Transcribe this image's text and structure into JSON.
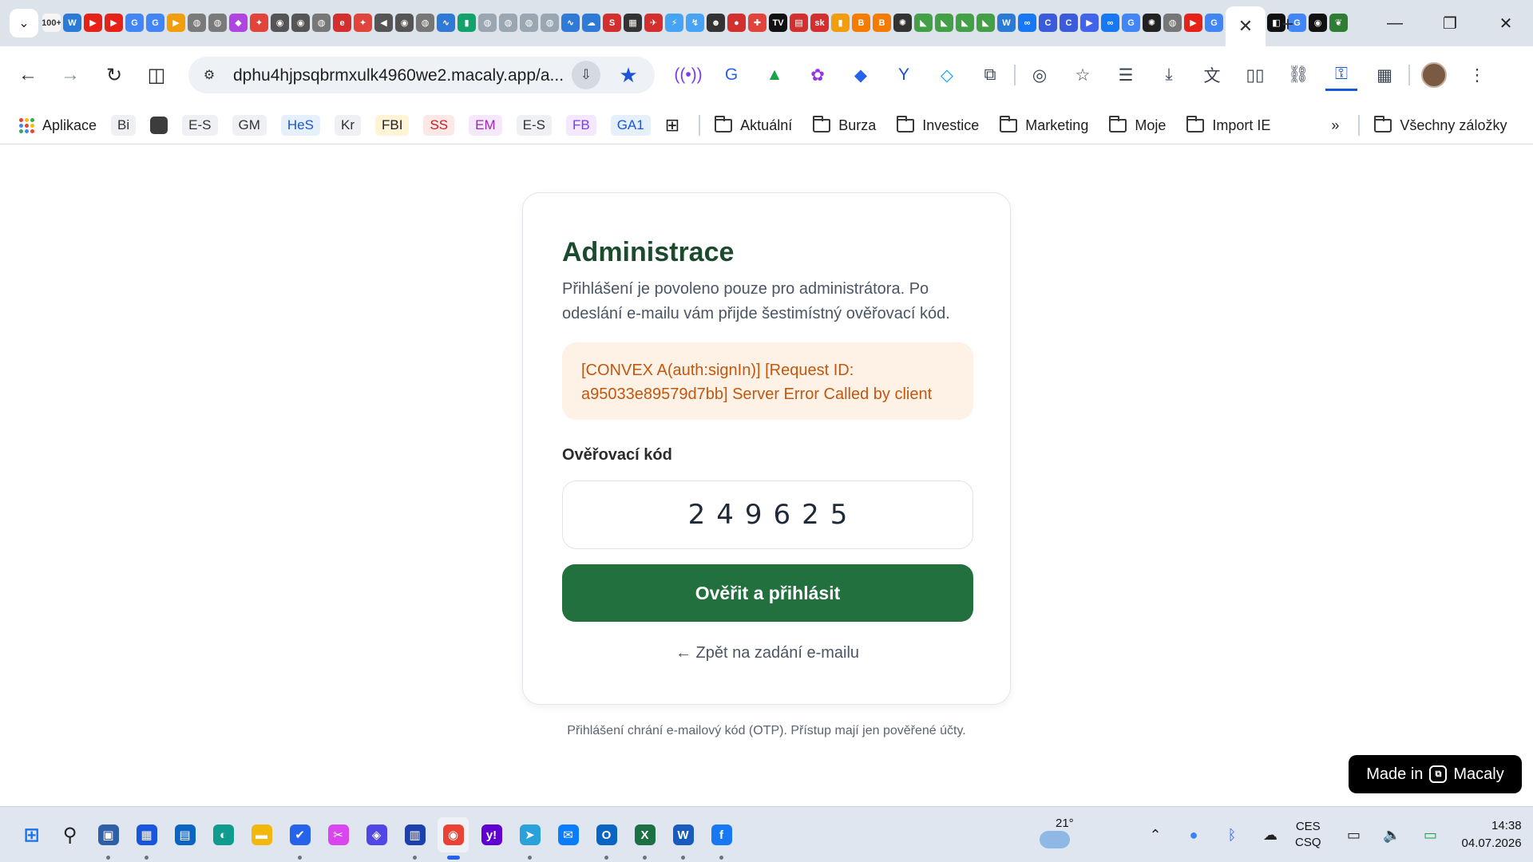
{
  "browser": {
    "url": "dphu4hjpsqbrmxulk4960we2.macaly.app/a...",
    "pinned_tabs": [
      {
        "icon": "100plus-icon",
        "text": "100+",
        "color": "#f5f5f5"
      },
      {
        "icon": "w-icon",
        "text": "W",
        "color": "#2b7bd6"
      },
      {
        "icon": "youtube-icon",
        "text": "▶",
        "color": "#e62117"
      },
      {
        "icon": "youtube-icon",
        "text": "▶",
        "color": "#e62117"
      },
      {
        "icon": "google-icon",
        "text": "G",
        "color": "#4285f4"
      },
      {
        "icon": "google-icon",
        "text": "G",
        "color": "#4285f4"
      },
      {
        "icon": "play-icon",
        "text": "▶",
        "color": "#f29d0c"
      },
      {
        "icon": "globe-icon",
        "text": "◍",
        "color": "#7a7a7a"
      },
      {
        "icon": "globe-icon",
        "text": "◍",
        "color": "#7a7a7a"
      },
      {
        "icon": "app-icon",
        "text": "◆",
        "color": "#b044e0"
      },
      {
        "icon": "bird-icon",
        "text": "✦",
        "color": "#e0443a"
      },
      {
        "icon": "eye-icon",
        "text": "◉",
        "color": "#555555"
      },
      {
        "icon": "eye-icon",
        "text": "◉",
        "color": "#555555"
      },
      {
        "icon": "globe-icon",
        "text": "◍",
        "color": "#777777"
      },
      {
        "icon": "red-app-icon",
        "text": "e",
        "color": "#d32f2f"
      },
      {
        "icon": "bird-icon",
        "text": "✦",
        "color": "#e0443a"
      },
      {
        "icon": "speaker-icon",
        "text": "◀",
        "color": "#555555"
      },
      {
        "icon": "eye-icon",
        "text": "◉",
        "color": "#555555"
      },
      {
        "icon": "globe-icon",
        "text": "◍",
        "color": "#777777"
      },
      {
        "icon": "chart-icon",
        "text": "∿",
        "color": "#2f7ad6"
      },
      {
        "icon": "bars-icon",
        "text": "▮",
        "color": "#12a36d"
      },
      {
        "icon": "globe-icon",
        "text": "◍",
        "color": "#9aa6b2"
      },
      {
        "icon": "globe-icon",
        "text": "◍",
        "color": "#9aa6b2"
      },
      {
        "icon": "globe-icon",
        "text": "◍",
        "color": "#9aa6b2"
      },
      {
        "icon": "globe-icon",
        "text": "◍",
        "color": "#9aa6b2"
      },
      {
        "icon": "chart-icon",
        "text": "∿",
        "color": "#2f7ad6"
      },
      {
        "icon": "cloud-icon",
        "text": "☁",
        "color": "#2f7ad6"
      },
      {
        "icon": "s-icon",
        "text": "S",
        "color": "#d32f2f"
      },
      {
        "icon": "vault-icon",
        "text": "▦",
        "color": "#333333"
      },
      {
        "icon": "plane-icon",
        "text": "✈",
        "color": "#d32f2f"
      },
      {
        "icon": "stats-icon",
        "text": "⚡",
        "color": "#47a3f3"
      },
      {
        "icon": "zig-icon",
        "text": "↯",
        "color": "#47a3f3"
      },
      {
        "icon": "person-icon",
        "text": "☻",
        "color": "#333333"
      },
      {
        "icon": "red-dot-icon",
        "text": "●",
        "color": "#d32f2f"
      },
      {
        "icon": "plus-icon",
        "text": "✚",
        "color": "#e0443a"
      },
      {
        "icon": "tv-icon",
        "text": "TV",
        "color": "#111111"
      },
      {
        "icon": "news-icon",
        "text": "▤",
        "color": "#d32f2f"
      },
      {
        "icon": "sk-icon",
        "text": "sk",
        "color": "#d32f2f"
      },
      {
        "icon": "bars-icon",
        "text": "▮",
        "color": "#f29d0c"
      },
      {
        "icon": "b-icon",
        "text": "B",
        "color": "#f57c00"
      },
      {
        "icon": "blogger-icon",
        "text": "B",
        "color": "#f57c00"
      },
      {
        "icon": "openai-icon",
        "text": "✺",
        "color": "#333333"
      },
      {
        "icon": "green-icon",
        "text": "◣",
        "color": "#43a047"
      },
      {
        "icon": "green-icon",
        "text": "◣",
        "color": "#43a047"
      },
      {
        "icon": "green-icon",
        "text": "◣",
        "color": "#43a047"
      },
      {
        "icon": "green-icon",
        "text": "◣",
        "color": "#43a047"
      },
      {
        "icon": "w-icon",
        "text": "W",
        "color": "#2b7bd6"
      },
      {
        "icon": "meta-icon",
        "text": "∞",
        "color": "#1877f2"
      },
      {
        "icon": "c-icon",
        "text": "C",
        "color": "#3b5bdb"
      },
      {
        "icon": "c-icon",
        "text": "C",
        "color": "#3b5bdb"
      },
      {
        "icon": "play-icon",
        "text": "▶",
        "color": "#4263eb"
      },
      {
        "icon": "meta-icon",
        "text": "∞",
        "color": "#1877f2"
      },
      {
        "icon": "google-icon",
        "text": "G",
        "color": "#4285f4"
      },
      {
        "icon": "openai-icon",
        "text": "✺",
        "color": "#222222"
      },
      {
        "icon": "globe-icon",
        "text": "◍",
        "color": "#777777"
      },
      {
        "icon": "youtube-icon",
        "text": "▶",
        "color": "#e62117"
      },
      {
        "icon": "google-icon",
        "text": "G",
        "color": "#4285f4"
      },
      {
        "icon": "wand-icon",
        "text": "✎",
        "color": "#555555"
      },
      {
        "icon": "vault-icon",
        "text": "◧",
        "color": "#111111"
      },
      {
        "icon": "vault-icon",
        "text": "◧",
        "color": "#111111"
      },
      {
        "icon": "google-icon",
        "text": "G",
        "color": "#4285f4"
      },
      {
        "icon": "ring-icon",
        "text": "◉",
        "color": "#111111"
      },
      {
        "icon": "leaf-icon",
        "text": "❦",
        "color": "#2e7d32"
      }
    ],
    "bookmarks": {
      "apps_label": "Aplikace",
      "chips": [
        {
          "label": "Bi",
          "bg": "#eef0f3",
          "fg": "#333333"
        },
        {
          "label": "",
          "bg": "#3c3c3c",
          "fg": "#ffffff"
        },
        {
          "label": "E-S",
          "bg": "#eef0f3",
          "fg": "#333333"
        },
        {
          "label": "GM",
          "bg": "#eef0f3",
          "fg": "#333333"
        },
        {
          "label": "HeS",
          "bg": "#e6effc",
          "fg": "#1a56db"
        },
        {
          "label": "Kr",
          "bg": "#eef0f3",
          "fg": "#333333"
        },
        {
          "label": "FBI",
          "bg": "#fff5d6",
          "fg": "#222222"
        },
        {
          "label": "SS",
          "bg": "#fde8e8",
          "fg": "#c81e1e"
        },
        {
          "label": "EM",
          "bg": "#f6e8fb",
          "fg": "#9c27b0"
        },
        {
          "label": "E-S",
          "bg": "#eef0f3",
          "fg": "#333333"
        },
        {
          "label": "FB",
          "bg": "#f3e8fd",
          "fg": "#7e3af2"
        },
        {
          "label": "GA1",
          "bg": "#e6effc",
          "fg": "#1a56db"
        }
      ],
      "folders": [
        "Aktuální",
        "Burza",
        "Investice",
        "Marketing",
        "Moje",
        "Import IE"
      ],
      "more": "»",
      "all_bookmarks": "Všechny záložky"
    }
  },
  "page": {
    "title": "Administrace",
    "subtitle": "Přihlášení je povoleno pouze pro administrátora. Po odeslání e-mailu vám přijde šestimístný ověřovací kód.",
    "error": "[CONVEX A(auth:signIn)] [Request ID: a95033e89579d7bb] Server Error Called by client",
    "code_label": "Ověřovací kód",
    "code_value": "249625",
    "submit_label": "Ověřit a přihlásit",
    "back_link": "← Zpět na zadání e-mailu",
    "footer_note": "Přihlášení chrání e-mailový kód (OTP). Přístup mají jen pověřené účty.",
    "badge_text": "Made in",
    "badge_brand": "Macaly",
    "colors": {
      "primary": "#23703f",
      "title": "#1c4a2d",
      "error_bg": "#fef1e6",
      "error_text": "#c2570f"
    }
  },
  "taskbar": {
    "apps": [
      {
        "name": "start-icon",
        "glyph": "⊞",
        "color": "#1a73e8",
        "dot": false
      },
      {
        "name": "search-icon",
        "glyph": "⚲",
        "color": "#222222",
        "dot": false
      },
      {
        "name": "shield-app-icon",
        "glyph": "▣",
        "color": "#2f5fa7",
        "dot": true
      },
      {
        "name": "calendar-app-icon",
        "glyph": "▦",
        "color": "#1a56db",
        "dot": true
      },
      {
        "name": "outlook-app-icon",
        "glyph": "▤",
        "color": "#0a64c2",
        "dot": false
      },
      {
        "name": "edge-icon",
        "glyph": "◐",
        "color": "#0f9b8e",
        "dot": false
      },
      {
        "name": "file-explorer-icon",
        "glyph": "▬",
        "color": "#f2b90c",
        "dot": false
      },
      {
        "name": "todo-icon",
        "glyph": "✔",
        "color": "#2563eb",
        "dot": true
      },
      {
        "name": "snipping-tool-icon",
        "glyph": "✂",
        "color": "#d946ef",
        "dot": false
      },
      {
        "name": "photos-icon",
        "glyph": "◈",
        "color": "#4f46e5",
        "dot": false
      },
      {
        "name": "store-icon",
        "glyph": "▥",
        "color": "#1e40af",
        "dot": true
      },
      {
        "name": "chrome-icon",
        "glyph": "◉",
        "color": "#ea4335",
        "dot": true,
        "active": true
      },
      {
        "name": "yahoo-icon",
        "glyph": "y!",
        "color": "#6001d2",
        "dot": false
      },
      {
        "name": "telegram-icon",
        "glyph": "➤",
        "color": "#2aa1da",
        "dot": true
      },
      {
        "name": "messenger-icon",
        "glyph": "✉",
        "color": "#0a7cff",
        "dot": false
      },
      {
        "name": "outlook-icon",
        "glyph": "O",
        "color": "#0a64c2",
        "dot": true
      },
      {
        "name": "excel-icon",
        "glyph": "X",
        "color": "#1d7044",
        "dot": true
      },
      {
        "name": "word-icon",
        "glyph": "W",
        "color": "#185abd",
        "dot": true
      },
      {
        "name": "facebook-icon",
        "glyph": "f",
        "color": "#1877f2",
        "dot": true
      }
    ],
    "weather_temp": "21°",
    "lang_top": "CES",
    "lang_bottom": "CSQ",
    "time": "14:38",
    "date": "04.07.2026"
  }
}
